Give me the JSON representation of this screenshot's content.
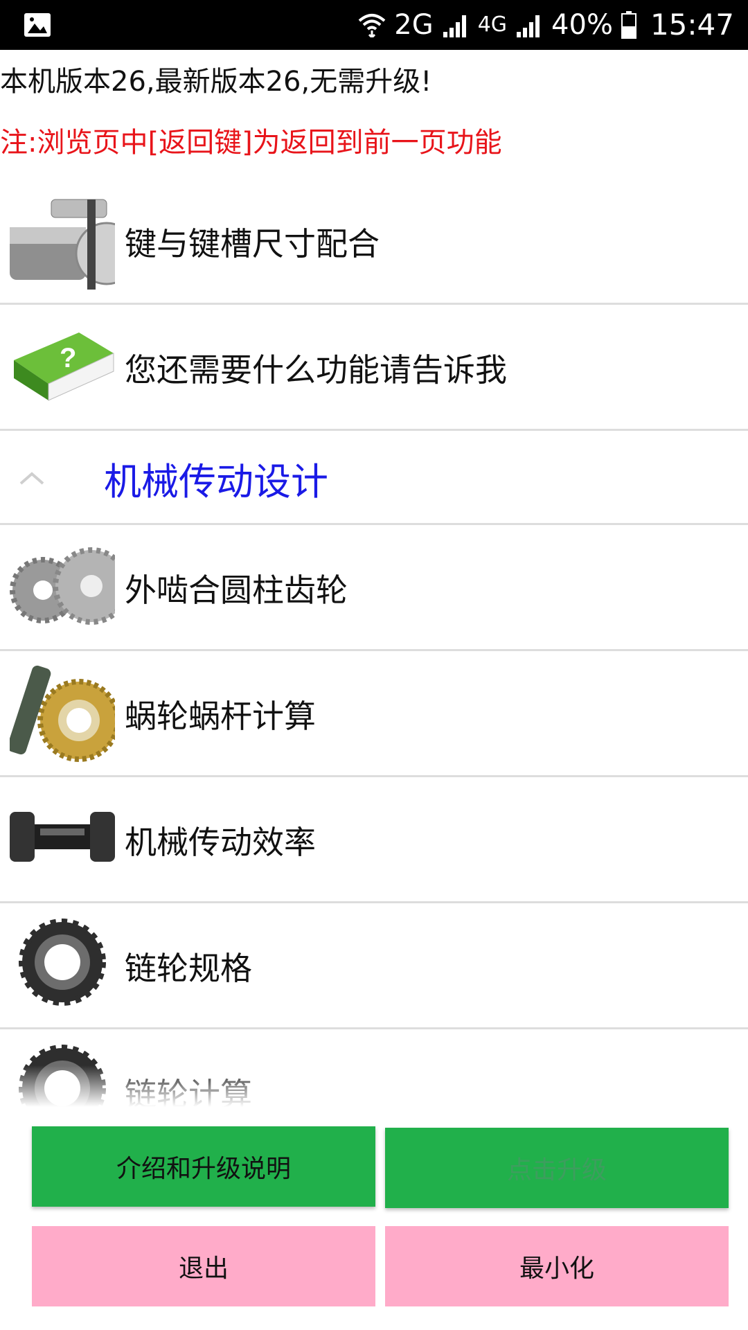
{
  "status_bar": {
    "network_2g": "2G",
    "network_4g": "4G",
    "battery": "40%",
    "time": "15:47",
    "icons": [
      "image-icon",
      "wifi-icon",
      "signal-icon",
      "battery-icon"
    ]
  },
  "header": {
    "version_text": "本机版本26,最新版本26,无需升级!",
    "note_text": "注:浏览页中[返回键]为返回到前一页功能",
    "note_color": "#e8141a"
  },
  "list": {
    "items": [
      {
        "label": "键与键槽尺寸配合",
        "icon": "key-shaft-icon"
      },
      {
        "label": "您还需要什么功能请告诉我",
        "icon": "help-book-icon"
      }
    ],
    "group": {
      "title": "机械传动设计",
      "title_color": "#1a1ae6",
      "icon": "chevron-up-icon"
    },
    "group_items": [
      {
        "label": "外啮合圆柱齿轮",
        "icon": "spur-gears-icon"
      },
      {
        "label": "蜗轮蜗杆计算",
        "icon": "worm-gear-icon"
      },
      {
        "label": "机械传动效率",
        "icon": "drive-shaft-icon"
      },
      {
        "label": "链轮规格",
        "icon": "sprocket-icon"
      },
      {
        "label": "链轮计算",
        "icon": "sprocket-icon"
      }
    ]
  },
  "buttons": {
    "intro_label": "介绍和升级说明",
    "upgrade_label": "点击升级",
    "exit_label": "退出",
    "minimize_label": "最小化",
    "green": "#21b04b",
    "pink": "#ffabc9"
  }
}
